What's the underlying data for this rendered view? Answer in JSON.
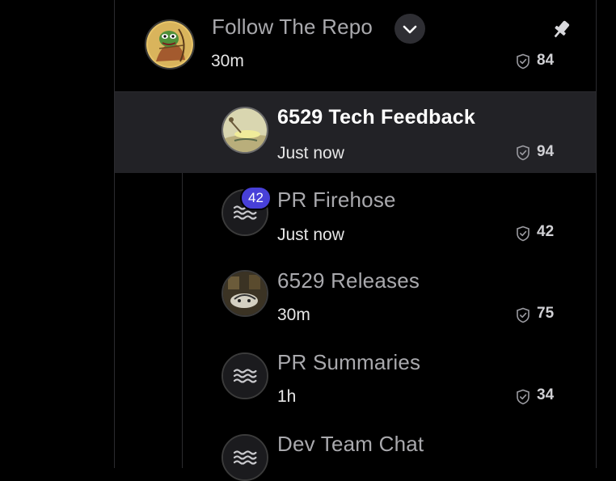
{
  "group": {
    "title": "Follow The Repo",
    "time": "30m",
    "score": "84",
    "icons": {
      "dropdown": "chevron-down-icon",
      "pin": "pin-icon",
      "shield": "shield-icon"
    }
  },
  "channels": [
    {
      "title": "6529 Tech Feedback",
      "time": "Just now",
      "score": "94",
      "selected": true
    },
    {
      "title": "PR Firehose",
      "time": "Just now",
      "score": "42",
      "badge": "42",
      "icon": "waves-icon"
    },
    {
      "title": "6529 Releases",
      "time": "30m",
      "score": "75"
    },
    {
      "title": "PR Summaries",
      "time": "1h",
      "score": "34",
      "icon": "waves-icon"
    },
    {
      "title": "Dev Team Chat",
      "icon": "waves-icon"
    }
  ],
  "colors": {
    "background": "#000000",
    "selected_row": "#222226",
    "badge": "#4840d8",
    "muted_text": "#a9a9ad"
  }
}
